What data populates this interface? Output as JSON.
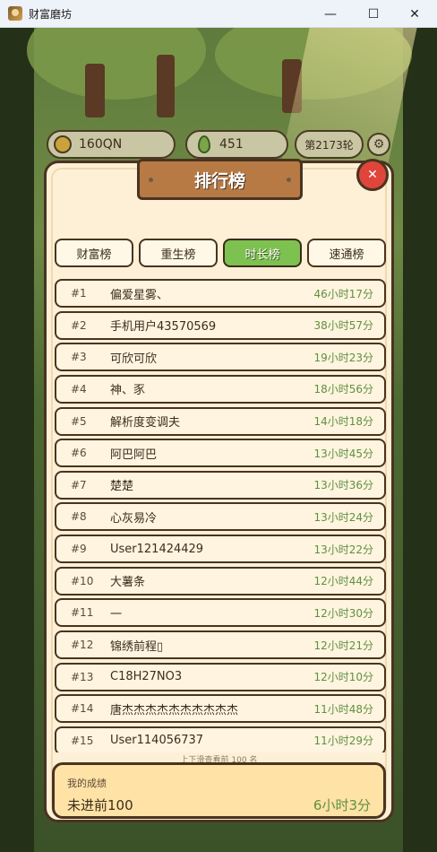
{
  "window": {
    "title": "财富磨坊",
    "minimize": "—",
    "maximize": "☐",
    "close": "✕"
  },
  "hud": {
    "coins": "160QN",
    "seeds": "451",
    "round": "第2173轮",
    "settings_icon": "⚙"
  },
  "panel": {
    "title": "排行榜",
    "close": "✕",
    "tabs": [
      "财富榜",
      "重生榜",
      "时长榜",
      "速通榜"
    ],
    "active_tab": 2,
    "rows": [
      {
        "rank": "#1",
        "name": "偏爱星雾、",
        "time": "46小时17分"
      },
      {
        "rank": "#2",
        "name": "手机用户43570569",
        "time": "38小时57分"
      },
      {
        "rank": "#3",
        "name": "可欣可欣",
        "time": "19小时23分"
      },
      {
        "rank": "#4",
        "name": "神、豕",
        "time": "18小时56分"
      },
      {
        "rank": "#5",
        "name": "解析度变调夫",
        "time": "14小时18分"
      },
      {
        "rank": "#6",
        "name": "阿巴阿巴",
        "time": "13小时45分"
      },
      {
        "rank": "#7",
        "name": "楚楚",
        "time": "13小时36分"
      },
      {
        "rank": "#8",
        "name": "心灰易冷",
        "time": "13小时24分"
      },
      {
        "rank": "#9",
        "name": "User121424429",
        "time": "13小时22分"
      },
      {
        "rank": "#10",
        "name": "大薯条",
        "time": "12小时44分"
      },
      {
        "rank": "#11",
        "name": "一",
        "time": "12小时30分"
      },
      {
        "rank": "#12",
        "name": "锦绣前程▯",
        "time": "12小时21分"
      },
      {
        "rank": "#13",
        "name": "C18H27NO3",
        "time": "12小时10分"
      },
      {
        "rank": "#14",
        "name": "唐杰杰杰杰杰杰杰杰杰杰",
        "time": "11小时48分"
      },
      {
        "rank": "#15",
        "name": "User114056737",
        "time": "11小时29分"
      }
    ],
    "scroll_hint": "上下滑查看前 100 名",
    "my_result": {
      "label": "我的成绩",
      "rank_text": "未进前100",
      "time": "6小时3分"
    }
  }
}
